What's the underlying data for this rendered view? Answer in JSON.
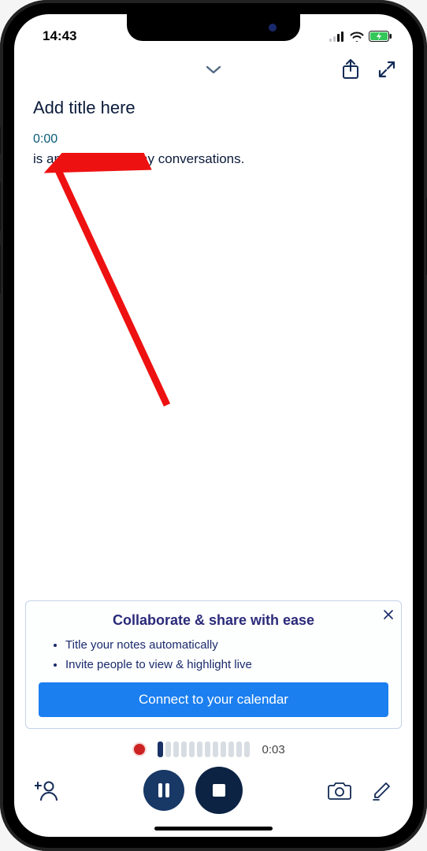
{
  "status": {
    "time": "14:43"
  },
  "header": {},
  "note": {
    "title_placeholder": "Add title here",
    "timestamp": "0:00",
    "transcript_line": "is an AI for everyday conversations."
  },
  "promo": {
    "title": "Collaborate & share with ease",
    "bullets": [
      "Title your notes automatically",
      "Invite people to view & highlight live"
    ],
    "cta": "Connect to your calendar"
  },
  "recording": {
    "elapsed": "0:03"
  }
}
